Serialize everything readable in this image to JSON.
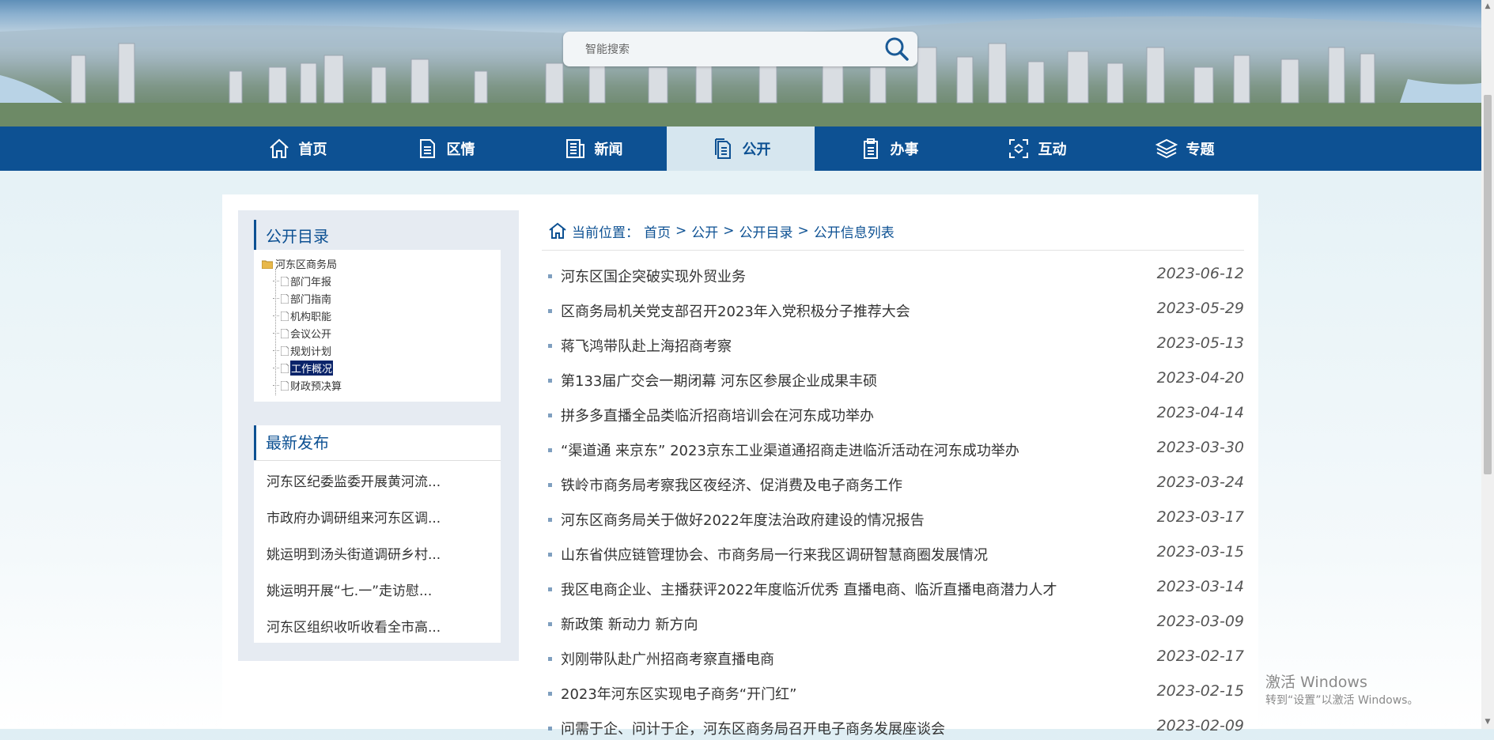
{
  "search": {
    "placeholder": "智能搜索"
  },
  "nav": {
    "items": [
      {
        "label": "首页",
        "icon": "home-icon"
      },
      {
        "label": "区情",
        "icon": "document-icon"
      },
      {
        "label": "新闻",
        "icon": "news-icon"
      },
      {
        "label": "公开",
        "icon": "public-doc-icon",
        "active": true
      },
      {
        "label": "办事",
        "icon": "clipboard-icon"
      },
      {
        "label": "互动",
        "icon": "interact-icon"
      },
      {
        "label": "专题",
        "icon": "layers-icon"
      }
    ]
  },
  "sidebar": {
    "catalog_title": "公开目录",
    "tree": {
      "root": "河东区商务局",
      "nodes": [
        "部门年报",
        "部门指南",
        "机构职能",
        "会议公开",
        "规划计划",
        "工作概况",
        "财政预决算"
      ],
      "selected": "工作概况"
    },
    "latest_title": "最新发布",
    "latest": [
      "河东区纪委监委开展黄河流...",
      "市政府办调研组来河东区调...",
      "姚运明到汤头街道调研乡村...",
      "姚运明开展“七.一”走访慰...",
      "河东区组织收听收看全市高..."
    ]
  },
  "breadcrumb": {
    "prefix": "当前位置：",
    "items": [
      "首页",
      "公开",
      "公开目录",
      "公开信息列表"
    ],
    "separator": ">"
  },
  "list": [
    {
      "title": "河东区国企突破实现外贸业务",
      "date": "2023-06-12"
    },
    {
      "title": "区商务局机关党支部召开2023年入党积极分子推荐大会",
      "date": "2023-05-29"
    },
    {
      "title": "蒋飞鸿带队赴上海招商考察",
      "date": "2023-05-13"
    },
    {
      "title": "第133届广交会一期闭幕 河东区参展企业成果丰硕",
      "date": "2023-04-20"
    },
    {
      "title": "拼多多直播全品类临沂招商培训会在河东成功举办",
      "date": "2023-04-14"
    },
    {
      "title": "“渠道通 来京东” 2023京东工业渠道通招商走进临沂活动在河东成功举办",
      "date": "2023-03-30"
    },
    {
      "title": "铁岭市商务局考察我区夜经济、促消费及电子商务工作",
      "date": "2023-03-24"
    },
    {
      "title": "河东区商务局关于做好2022年度法治政府建设的情况报告",
      "date": "2023-03-17"
    },
    {
      "title": "山东省供应链管理协会、市商务局一行来我区调研智慧商圈发展情况",
      "date": "2023-03-15"
    },
    {
      "title": "我区电商企业、主播获评2022年度临沂优秀 直播电商、临沂直播电商潜力人才",
      "date": "2023-03-14"
    },
    {
      "title": "新政策 新动力 新方向",
      "date": "2023-03-09"
    },
    {
      "title": "刘刚带队赴广州招商考察直播电商",
      "date": "2023-02-17"
    },
    {
      "title": "2023年河东区实现电子商务“开门红”",
      "date": "2023-02-15"
    },
    {
      "title": "问需于企、问计于企，河东区商务局召开电子商务发展座谈会",
      "date": "2023-02-09"
    }
  ],
  "watermark": {
    "line1": "激活 Windows",
    "line2": "转到“设置”以激活 Windows。"
  },
  "colors": {
    "primary": "#0d5193",
    "nav_active_bg": "#d6e6ef",
    "sidebar_bg": "#e6ebf2"
  }
}
